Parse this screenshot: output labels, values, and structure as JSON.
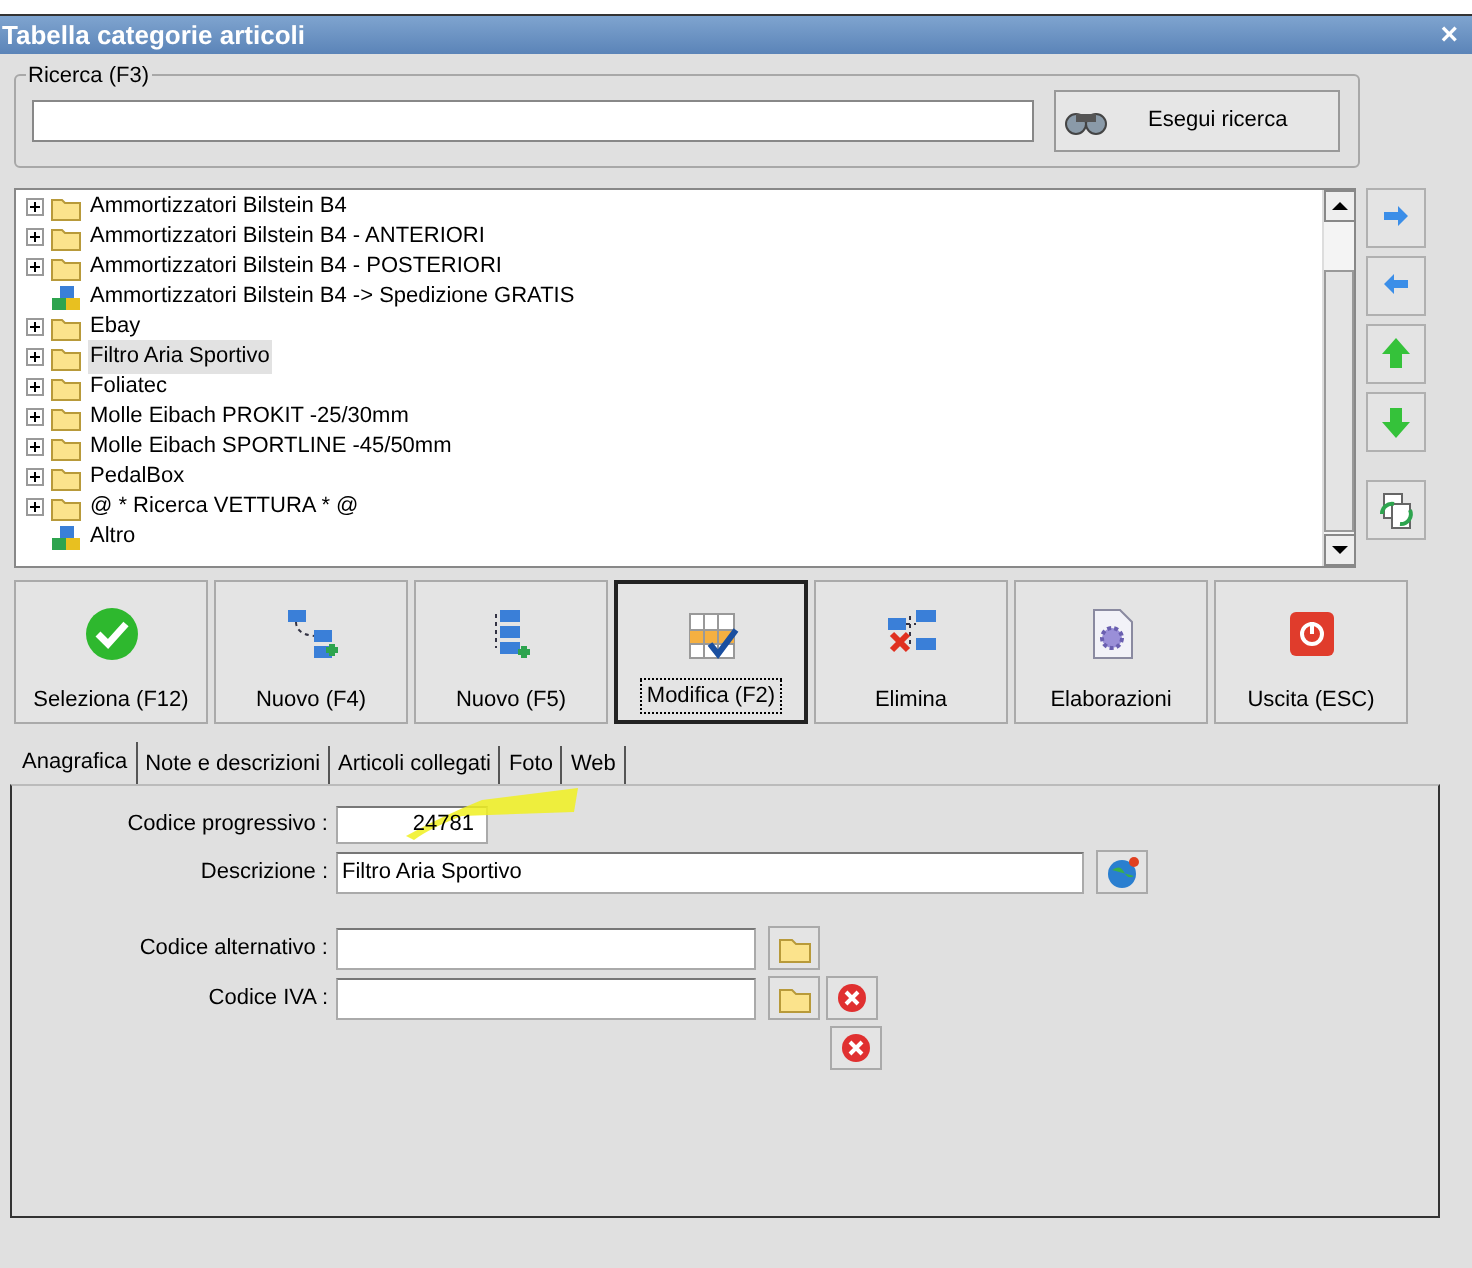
{
  "window": {
    "title": "Tabella categorie articoli",
    "close": "×"
  },
  "search": {
    "legend": "Ricerca (F3)",
    "button": "Esegui ricerca"
  },
  "tree": [
    {
      "label": "Ammortizzatori Bilstein B4",
      "kind": "folder",
      "expandable": true,
      "selected": false
    },
    {
      "label": "Ammortizzatori Bilstein B4 - ANTERIORI",
      "kind": "folder",
      "expandable": true,
      "selected": false
    },
    {
      "label": "Ammortizzatori Bilstein B4 - POSTERIORI",
      "kind": "folder",
      "expandable": true,
      "selected": false
    },
    {
      "label": "Ammortizzatori Bilstein B4 -> Spedizione GRATIS",
      "kind": "group",
      "expandable": false,
      "selected": false
    },
    {
      "label": "Ebay",
      "kind": "folder",
      "expandable": true,
      "selected": false
    },
    {
      "label": "Filtro Aria Sportivo",
      "kind": "folder",
      "expandable": true,
      "selected": true
    },
    {
      "label": "Foliatec",
      "kind": "folder",
      "expandable": true,
      "selected": false
    },
    {
      "label": "Molle Eibach PROKIT -25/30mm",
      "kind": "folder",
      "expandable": true,
      "selected": false
    },
    {
      "label": "Molle Eibach SPORTLINE -45/50mm",
      "kind": "folder",
      "expandable": true,
      "selected": false
    },
    {
      "label": "PedalBox",
      "kind": "folder",
      "expandable": true,
      "selected": false
    },
    {
      "label": "@ * Ricerca VETTURA * @",
      "kind": "folder",
      "expandable": true,
      "selected": false
    },
    {
      "label": "Altro",
      "kind": "group",
      "expandable": false,
      "selected": false
    }
  ],
  "side_buttons": [
    {
      "kind": "right"
    },
    {
      "kind": "left"
    },
    {
      "kind": "up"
    },
    {
      "kind": "down"
    },
    {
      "kind": "refresh"
    }
  ],
  "toolbar": [
    {
      "label": "Seleziona (F12)",
      "kind": "check",
      "focused": false
    },
    {
      "label": "Nuovo (F4)",
      "kind": "tree-add",
      "focused": false
    },
    {
      "label": "Nuovo (F5)",
      "kind": "list-add",
      "focused": false
    },
    {
      "label": "Modifica (F2)",
      "kind": "grid-check",
      "focused": true
    },
    {
      "label": "Elimina",
      "kind": "tree-delete",
      "focused": false
    },
    {
      "label": "Elaborazioni",
      "kind": "doc-gear",
      "focused": false
    },
    {
      "label": "Uscita (ESC)",
      "kind": "power",
      "focused": false
    }
  ],
  "tabs": [
    {
      "label": "Anagrafica",
      "selected": true
    },
    {
      "label": "Note e descrizioni",
      "selected": false
    },
    {
      "label": "Articoli collegati",
      "selected": false
    },
    {
      "label": "Foto",
      "selected": false
    },
    {
      "label": "Web",
      "selected": false
    }
  ],
  "form": [
    {
      "label": "Codice progressivo :",
      "value": "24781",
      "kind": "code"
    },
    {
      "label": "Descrizione :",
      "value": "Filtro Aria Sportivo",
      "kind": "wide",
      "buttons": [
        {
          "kind": "globe"
        }
      ]
    },
    {
      "label": "Codice alternativo :",
      "kind": "medium",
      "buttons": [
        {
          "kind": "folder"
        }
      ]
    },
    {
      "label": "Codice IVA :",
      "kind": "medium",
      "buttons": [
        {
          "kind": "folder"
        },
        {
          "kind": "delete"
        }
      ]
    },
    {
      "kind": "buttons-only",
      "buttons": [
        {
          "kind": "delete"
        }
      ]
    }
  ]
}
